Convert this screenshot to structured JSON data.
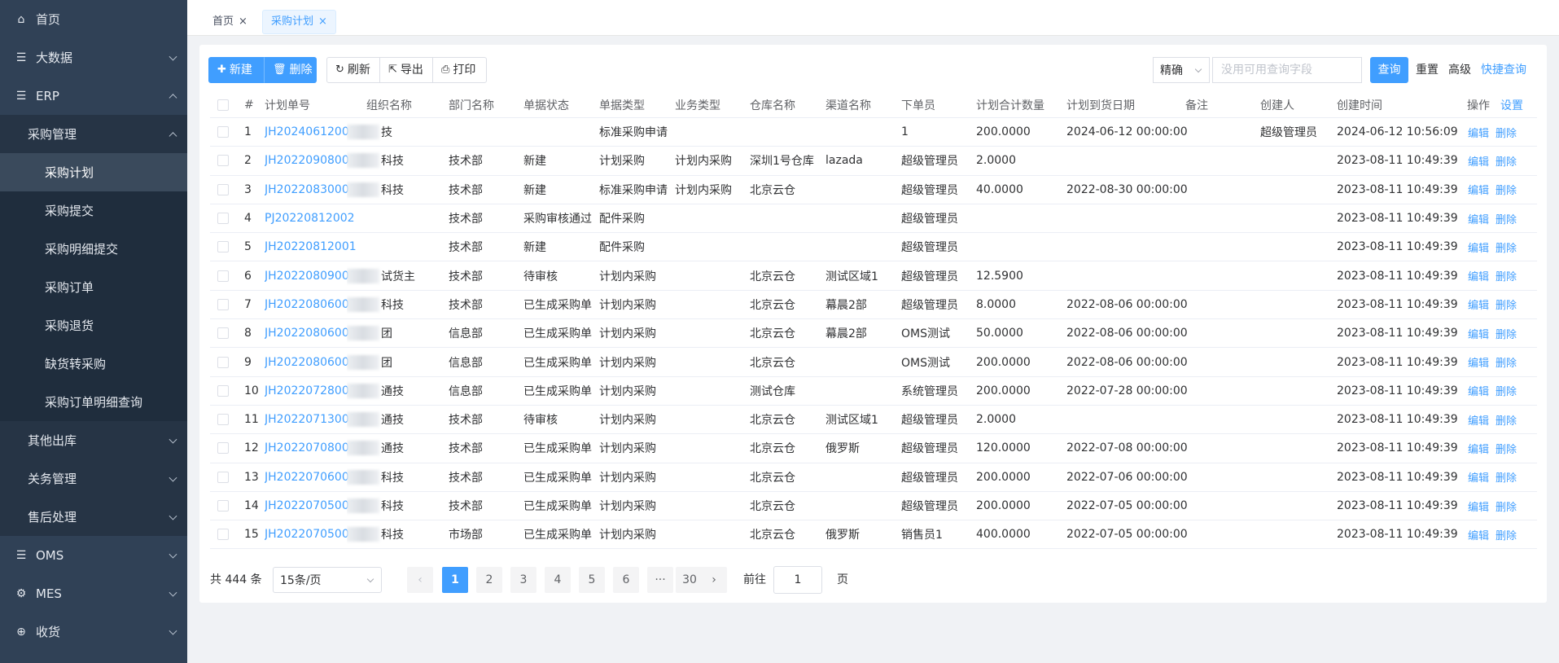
{
  "sidebar": {
    "items": [
      {
        "label": "首页",
        "icon": "home-icon",
        "level": 1,
        "chevron": ""
      },
      {
        "label": "大数据",
        "icon": "list-icon",
        "level": 1,
        "chevron": "down"
      },
      {
        "label": "ERP",
        "icon": "list-icon",
        "level": 1,
        "chevron": "up"
      },
      {
        "label": "采购管理",
        "icon": "",
        "level": 2,
        "chevron": "up"
      },
      {
        "label": "采购计划",
        "icon": "",
        "level": 3,
        "chevron": "",
        "active": true
      },
      {
        "label": "采购提交",
        "icon": "",
        "level": 3,
        "chevron": ""
      },
      {
        "label": "采购明细提交",
        "icon": "",
        "level": 3,
        "chevron": ""
      },
      {
        "label": "采购订单",
        "icon": "",
        "level": 3,
        "chevron": ""
      },
      {
        "label": "采购退货",
        "icon": "",
        "level": 3,
        "chevron": ""
      },
      {
        "label": "缺货转采购",
        "icon": "",
        "level": 3,
        "chevron": ""
      },
      {
        "label": "采购订单明细查询",
        "icon": "",
        "level": 3,
        "chevron": ""
      },
      {
        "label": "其他出库",
        "icon": "",
        "level": 2,
        "chevron": "down"
      },
      {
        "label": "关务管理",
        "icon": "",
        "level": 2,
        "chevron": "down"
      },
      {
        "label": "售后处理",
        "icon": "",
        "level": 2,
        "chevron": "down"
      },
      {
        "label": "OMS",
        "icon": "list-icon",
        "level": 1,
        "chevron": "down"
      },
      {
        "label": "MES",
        "icon": "gear-icon",
        "level": 1,
        "chevron": "down"
      },
      {
        "label": "收货",
        "icon": "box-icon",
        "level": 1,
        "chevron": "down"
      }
    ]
  },
  "tabs": [
    {
      "label": "首页",
      "close": "×"
    },
    {
      "label": "采购计划",
      "close": "×"
    }
  ],
  "toolbar": {
    "new_label": "新建",
    "delete_label": "删除",
    "refresh_label": "刷新",
    "export_label": "导出",
    "print_label": "打印",
    "match_select": "精确",
    "search_placeholder": "没用可用查询字段",
    "query_label": "查询",
    "reset_label": "重置",
    "advanced_label": "高级",
    "quick_query_label": "快捷查询"
  },
  "table": {
    "headers": {
      "index": "#",
      "plan_no": "计划单号",
      "org": "组织名称",
      "dept": "部门名称",
      "status": "单据状态",
      "doc_type": "单据类型",
      "biz_type": "业务类型",
      "warehouse": "仓库名称",
      "channel": "渠道名称",
      "orderer": "下单员",
      "qty": "计划合计数量",
      "arrival": "计划到货日期",
      "remark": "备注",
      "creator": "创建人",
      "created": "创建时间",
      "ops": "操作",
      "settings": "设置"
    },
    "edit_label": "编辑",
    "delete_label": "删除",
    "rows": [
      {
        "index": "1",
        "plan_no": "JH20240612001",
        "org": "技",
        "dept": "",
        "status": "",
        "doc_type": "标准采购申请",
        "biz_type": "",
        "warehouse": "",
        "channel": "",
        "orderer": "1",
        "qty": "200.0000",
        "arrival": "2024-06-12 00:00:00",
        "remark": "",
        "creator": "超级管理员",
        "created": "2024-06-12 10:56:09"
      },
      {
        "index": "2",
        "plan_no": "JH20220908001",
        "org": "科技",
        "dept": "技术部",
        "status": "新建",
        "doc_type": "计划采购",
        "biz_type": "计划内采购",
        "warehouse": "深圳1号仓库",
        "channel": "lazada",
        "orderer": "超级管理员",
        "qty": "2.0000",
        "arrival": "",
        "remark": "",
        "creator": "",
        "created": "2023-08-11 10:49:39"
      },
      {
        "index": "3",
        "plan_no": "JH20220830001",
        "org": "科技",
        "dept": "技术部",
        "status": "新建",
        "doc_type": "标准采购申请",
        "biz_type": "计划内采购",
        "warehouse": "北京云仓",
        "channel": "",
        "orderer": "超级管理员",
        "qty": "40.0000",
        "arrival": "2022-08-30 00:00:00",
        "remark": "",
        "creator": "",
        "created": "2023-08-11 10:49:39"
      },
      {
        "index": "4",
        "plan_no": "PJ20220812002",
        "org": "",
        "dept": "技术部",
        "status": "采购审核通过",
        "doc_type": "配件采购",
        "biz_type": "",
        "warehouse": "",
        "channel": "",
        "orderer": "超级管理员",
        "qty": "",
        "arrival": "",
        "remark": "",
        "creator": "",
        "created": "2023-08-11 10:49:39"
      },
      {
        "index": "5",
        "plan_no": "JH20220812001",
        "org": "",
        "dept": "技术部",
        "status": "新建",
        "doc_type": "配件采购",
        "biz_type": "",
        "warehouse": "",
        "channel": "",
        "orderer": "超级管理员",
        "qty": "",
        "arrival": "",
        "remark": "",
        "creator": "",
        "created": "2023-08-11 10:49:39"
      },
      {
        "index": "6",
        "plan_no": "JH20220809001",
        "org": "试货主",
        "dept": "技术部",
        "status": "待审核",
        "doc_type": "计划内采购",
        "biz_type": "",
        "warehouse": "北京云仓",
        "channel": "测试区域1",
        "orderer": "超级管理员",
        "qty": "12.5900",
        "arrival": "",
        "remark": "",
        "creator": "",
        "created": "2023-08-11 10:49:39"
      },
      {
        "index": "7",
        "plan_no": "JH20220806003",
        "org": "科技",
        "dept": "技术部",
        "status": "已生成采购单",
        "doc_type": "计划内采购",
        "biz_type": "",
        "warehouse": "北京云仓",
        "channel": "幕晨2部",
        "orderer": "超级管理员",
        "qty": "8.0000",
        "arrival": "2022-08-06 00:00:00",
        "remark": "",
        "creator": "",
        "created": "2023-08-11 10:49:39"
      },
      {
        "index": "8",
        "plan_no": "JH20220806002",
        "org": "团",
        "dept": "信息部",
        "status": "已生成采购单",
        "doc_type": "计划内采购",
        "biz_type": "",
        "warehouse": "北京云仓",
        "channel": "幕晨2部",
        "orderer": "OMS测试",
        "qty": "50.0000",
        "arrival": "2022-08-06 00:00:00",
        "remark": "",
        "creator": "",
        "created": "2023-08-11 10:49:39"
      },
      {
        "index": "9",
        "plan_no": "JH20220806001",
        "org": "团",
        "dept": "信息部",
        "status": "已生成采购单",
        "doc_type": "计划内采购",
        "biz_type": "",
        "warehouse": "北京云仓",
        "channel": "",
        "orderer": "OMS测试",
        "qty": "200.0000",
        "arrival": "2022-08-06 00:00:00",
        "remark": "",
        "creator": "",
        "created": "2023-08-11 10:49:39"
      },
      {
        "index": "10",
        "plan_no": "JH20220728001",
        "org": "通技",
        "dept": "信息部",
        "status": "已生成采购单",
        "doc_type": "计划内采购",
        "biz_type": "",
        "warehouse": "测试仓库",
        "channel": "",
        "orderer": "系统管理员",
        "qty": "200.0000",
        "arrival": "2022-07-28 00:00:00",
        "remark": "",
        "creator": "",
        "created": "2023-08-11 10:49:39"
      },
      {
        "index": "11",
        "plan_no": "JH20220713001",
        "org": "通技",
        "dept": "技术部",
        "status": "待审核",
        "doc_type": "计划内采购",
        "biz_type": "",
        "warehouse": "北京云仓",
        "channel": "测试区域1",
        "orderer": "超级管理员",
        "qty": "2.0000",
        "arrival": "",
        "remark": "",
        "creator": "",
        "created": "2023-08-11 10:49:39"
      },
      {
        "index": "12",
        "plan_no": "JH20220708001",
        "org": "通技",
        "dept": "技术部",
        "status": "已生成采购单",
        "doc_type": "计划内采购",
        "biz_type": "",
        "warehouse": "北京云仓",
        "channel": "俄罗斯",
        "orderer": "超级管理员",
        "qty": "120.0000",
        "arrival": "2022-07-08 00:00:00",
        "remark": "",
        "creator": "",
        "created": "2023-08-11 10:49:39"
      },
      {
        "index": "13",
        "plan_no": "JH20220706001",
        "org": "科技",
        "dept": "技术部",
        "status": "已生成采购单",
        "doc_type": "计划内采购",
        "biz_type": "",
        "warehouse": "北京云仓",
        "channel": "",
        "orderer": "超级管理员",
        "qty": "200.0000",
        "arrival": "2022-07-06 00:00:00",
        "remark": "",
        "creator": "",
        "created": "2023-08-11 10:49:39"
      },
      {
        "index": "14",
        "plan_no": "JH20220705002",
        "org": "科技",
        "dept": "技术部",
        "status": "已生成采购单",
        "doc_type": "计划内采购",
        "biz_type": "",
        "warehouse": "北京云仓",
        "channel": "",
        "orderer": "超级管理员",
        "qty": "200.0000",
        "arrival": "2022-07-05 00:00:00",
        "remark": "",
        "creator": "",
        "created": "2023-08-11 10:49:39"
      },
      {
        "index": "15",
        "plan_no": "JH20220705001",
        "org": "科技",
        "dept": "市场部",
        "status": "已生成采购单",
        "doc_type": "计划内采购",
        "biz_type": "",
        "warehouse": "北京云仓",
        "channel": "俄罗斯",
        "orderer": "销售员1",
        "qty": "400.0000",
        "arrival": "2022-07-05 00:00:00",
        "remark": "",
        "creator": "",
        "created": "2023-08-11 10:49:39"
      }
    ]
  },
  "pagination": {
    "total_label": "共 444 条",
    "page_size": "15条/页",
    "prev": "‹",
    "pages": [
      "1",
      "2",
      "3",
      "4",
      "5",
      "6",
      "···",
      "30"
    ],
    "next": "›",
    "goto_label": "前往",
    "goto_value": "1",
    "page_suffix": "页"
  },
  "colors": {
    "sidebar_bg": "#304156",
    "primary": "#409eff",
    "active_menu_bg": "#3a4a5c"
  }
}
